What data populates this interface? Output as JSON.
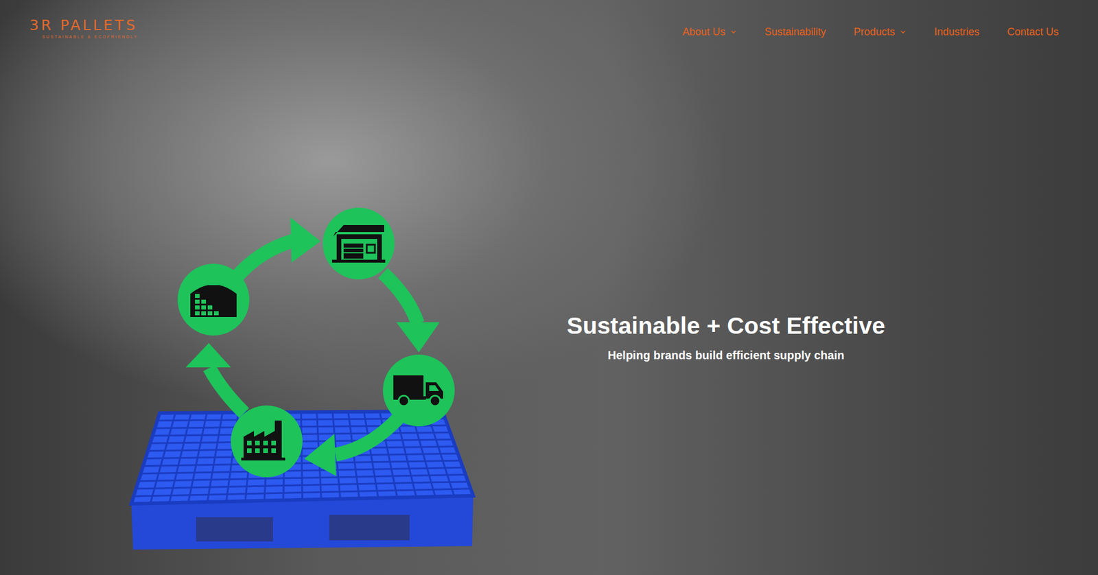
{
  "logo": {
    "title": "3R PALLETS",
    "tagline": "SUSTAINABLE & ECOFRIENDLY"
  },
  "nav": [
    {
      "label": "About Us",
      "dropdown": true
    },
    {
      "label": "Sustainability",
      "dropdown": false
    },
    {
      "label": "Products",
      "dropdown": true
    },
    {
      "label": "Industries",
      "dropdown": false
    },
    {
      "label": "Contact Us",
      "dropdown": false
    }
  ],
  "hero": {
    "title": "Sustainable + Cost Effective",
    "subtitle": "Helping brands build efficient supply chain"
  }
}
